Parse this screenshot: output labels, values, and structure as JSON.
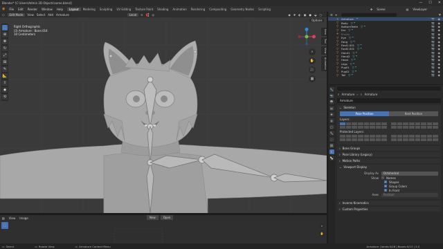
{
  "titlebar": {
    "title": "Blender* [C:\\Users\\Admin 2D Objects\\some.blend]",
    "minimize": "—",
    "maximize": "☐",
    "close": "✕"
  },
  "menubar": {
    "menus": [
      "File",
      "Edit",
      "Render",
      "Window",
      "Help"
    ],
    "workspaces": [
      "Layout",
      "Modeling",
      "Sculpting",
      "UV Editing",
      "Texture Paint",
      "Shading",
      "Animation",
      "Rendering",
      "Compositing",
      "Geometry Nodes",
      "Scripting"
    ],
    "active_workspace": "Layout",
    "scene": "Scene",
    "view_layer": "ViewLayer"
  },
  "viewport": {
    "mode": "Edit Mode",
    "menus": [
      "View",
      "Select",
      "Add",
      "Armature"
    ],
    "orientation": "Local",
    "options": "Options",
    "overlay_lines": [
      "Right Orthographic",
      "(3) Armature : Bone.014",
      "10 Centimeters"
    ],
    "side_tabs": [
      "Item",
      "Tool",
      "View",
      "Animation"
    ]
  },
  "image_editor": {
    "menus": [
      "View",
      "Image"
    ],
    "new_label": "New",
    "open_label": "Open"
  },
  "statusbar": {
    "items": [
      "Select",
      "Rotate View",
      "Armature Context Menu"
    ],
    "version": "Armature | Joints:0/28 | Bones:0/13 | 3.0"
  },
  "outliner": {
    "items": [
      {
        "label": "Armature",
        "icon": "armature",
        "selected": true,
        "mods": "ꟸ"
      },
      {
        "label": "Body",
        "icon": "mesh",
        "mods": "▽ ꟸ"
      },
      {
        "label": "BottomTeeth",
        "icon": "mesh",
        "mods": "▽ ꟸ"
      },
      {
        "label": "Ear",
        "icon": "mesh",
        "mods": "▽ ꟸ"
      },
      {
        "label": "Empty",
        "icon": "empty",
        "dim": true
      },
      {
        "label": "Eye",
        "icon": "mesh",
        "mods": "▽ ꟸ"
      },
      {
        "label": "Fang",
        "icon": "mesh",
        "mods": "▽ ꟸ"
      },
      {
        "label": "Foot1.001",
        "icon": "mesh",
        "mods": "▽ ꟸ"
      },
      {
        "label": "Foot2.001",
        "icon": "mesh",
        "mods": "▽ ꟸ"
      },
      {
        "label": "Hand1",
        "icon": "mesh",
        "mods": "▽ ꟸ"
      },
      {
        "label": "Hand2",
        "icon": "mesh",
        "mods": "▽ ꟸ"
      },
      {
        "label": "Head",
        "icon": "mesh",
        "mods": "▽ ꟸ"
      },
      {
        "label": "Legs",
        "icon": "mesh",
        "mods": "▽ ꟸ"
      },
      {
        "label": "Pupil1",
        "icon": "mesh",
        "mods": "▽ ꟸ"
      },
      {
        "label": "Pupil2",
        "icon": "mesh",
        "mods": "▽ ꟸ"
      },
      {
        "label": "Tail",
        "icon": "mesh",
        "mods": "▽ ꟸ"
      }
    ]
  },
  "properties": {
    "breadcrumb": [
      "Armature",
      "›",
      "Armature"
    ],
    "name": "Armature",
    "skeleton": {
      "title": "Skeleton",
      "pose_position": "Pose Position",
      "rest_position": "Rest Position",
      "active": "Pose Position",
      "layers_label": "Layers:",
      "protected_layers_label": "Protected Layers:"
    },
    "collapsed_panels": [
      "Bone Groups",
      "Pose Library (Legacy)",
      "Motion Paths"
    ],
    "viewport_display": {
      "title": "Viewport Display",
      "display_as_label": "Display As",
      "display_as_value": "Octahedral",
      "show_label": "Show",
      "checks": [
        {
          "label": "Names",
          "checked": false
        },
        {
          "label": "Shapes",
          "checked": true
        },
        {
          "label": "Group Colors",
          "checked": true
        },
        {
          "label": "In Front",
          "checked": true
        }
      ],
      "axes_label": "Axes",
      "axes_value": "Position"
    },
    "bottom_panels": [
      "Inverse Kinematics",
      "Custom Properties"
    ]
  },
  "colors": {
    "accent": "#4772b3",
    "viewport_bg": "#3a3a3a",
    "bone": "#bfbfbf"
  }
}
